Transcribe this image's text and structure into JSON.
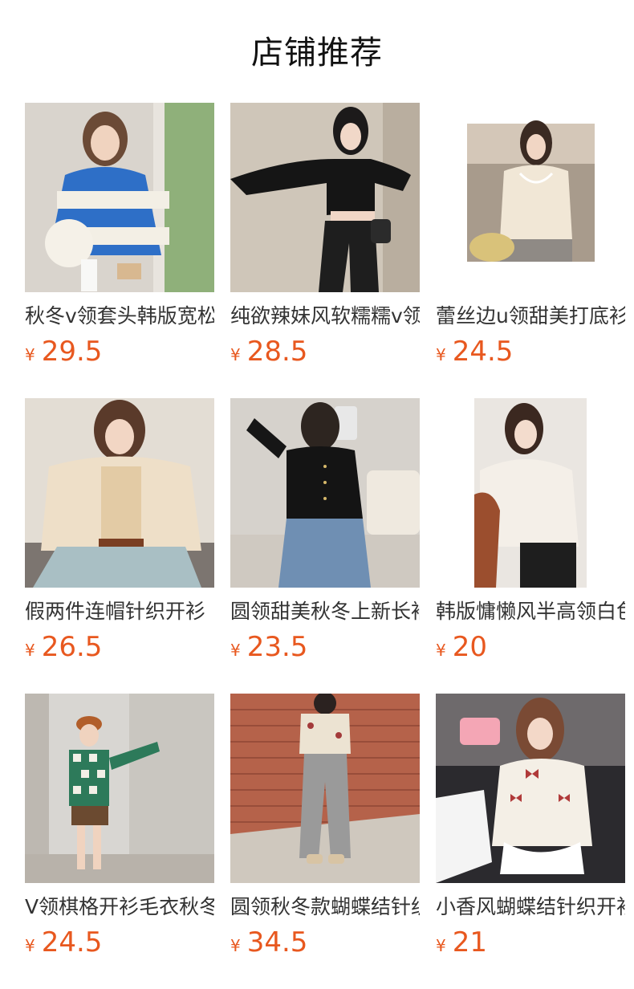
{
  "header": {
    "title": "店铺推荐"
  },
  "currency_symbol": "¥",
  "products": [
    {
      "title": "秋冬v领套头韩版宽松",
      "price": "29.5",
      "image": "blue-white-striped-sweater"
    },
    {
      "title": "纯欲辣妹风软糯糯v领",
      "price": "28.5",
      "image": "black-fuzzy-crop-cardigan"
    },
    {
      "title": "蕾丝边u领甜美打底衫",
      "price": "24.5",
      "image": "cream-lace-top"
    },
    {
      "title": "假两件连帽针织开衫",
      "price": "26.5",
      "image": "beige-hooded-knit-cardigan"
    },
    {
      "title": "圆领甜美秋冬上新长袖",
      "price": "23.5",
      "image": "black-button-cardigan"
    },
    {
      "title": "韩版慵懒风半高领白色",
      "price": "20",
      "image": "white-mock-neck-sweater"
    },
    {
      "title": "V领棋格开衫毛衣秋冬",
      "price": "24.5",
      "image": "green-checkered-cardigan"
    },
    {
      "title": "圆领秋冬款蝴蝶结针织",
      "price": "34.5",
      "image": "cream-bow-knit-top"
    },
    {
      "title": "小香风蝴蝶结针织开衫",
      "price": "21",
      "image": "white-bow-cardigan"
    }
  ],
  "colors": {
    "price": "#e8581f",
    "title": "#333333"
  }
}
